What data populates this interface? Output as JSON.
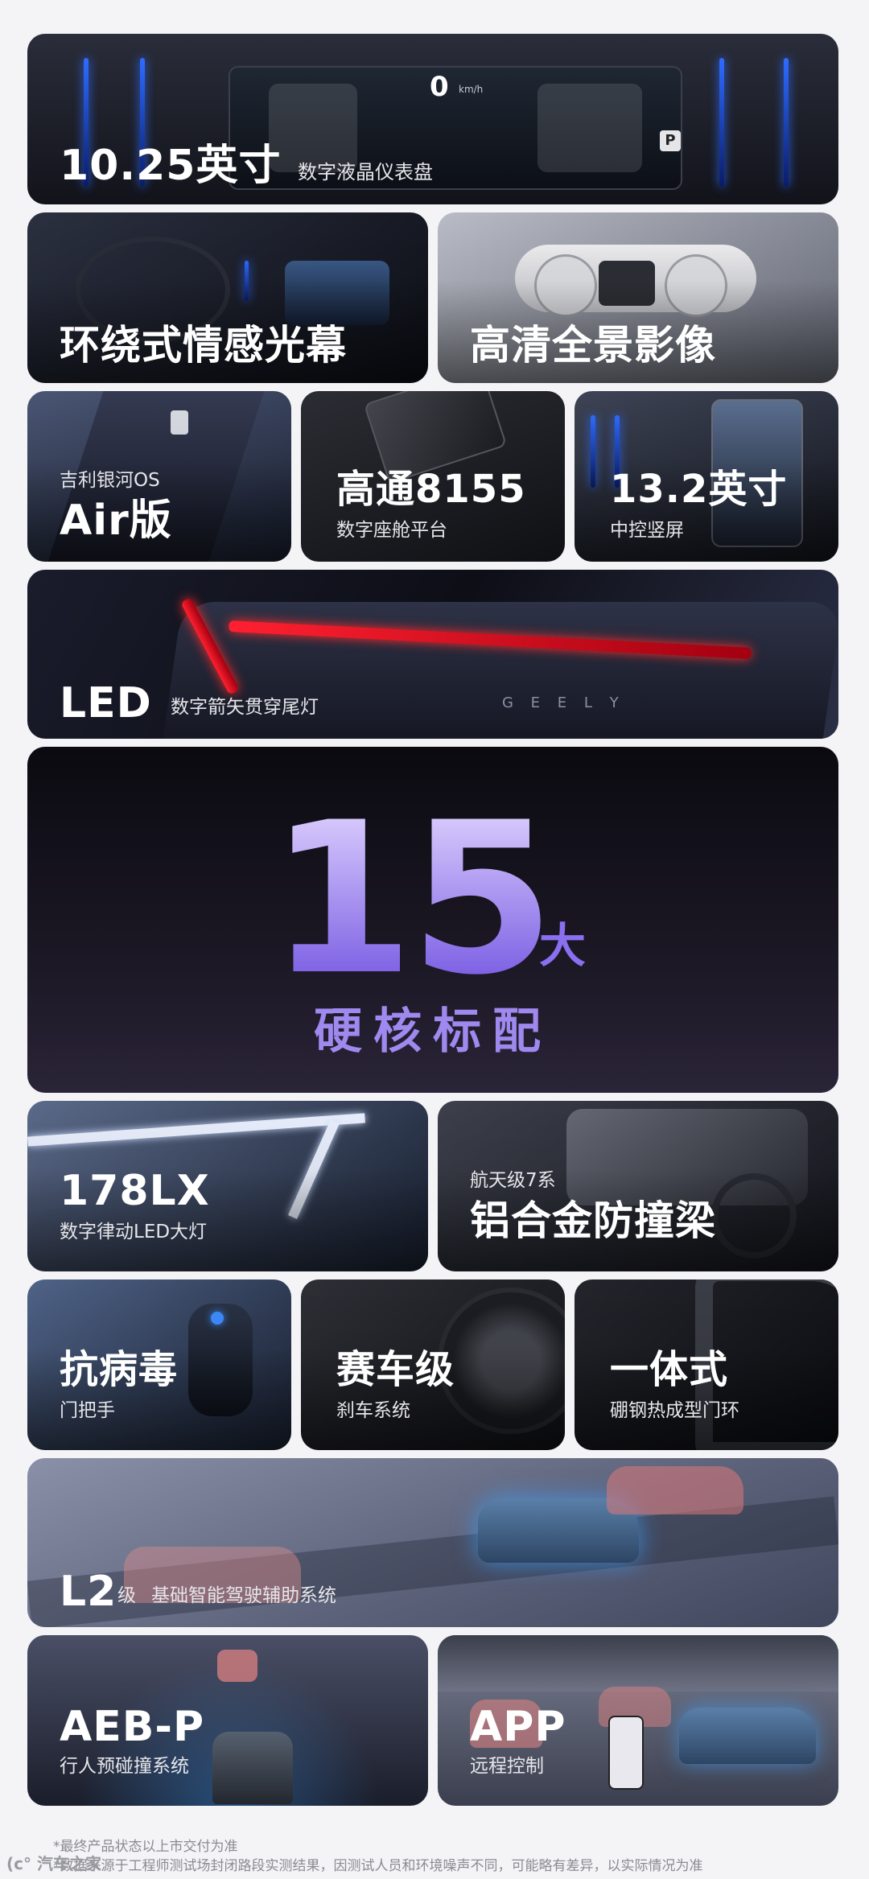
{
  "cards": {
    "dash": {
      "value": "10.25英寸",
      "label": "数字液晶仪表盘",
      "speed": "0",
      "speed_unit": "km/h",
      "gear": "P"
    },
    "lightscreen": {
      "title": "环绕式情感光幕"
    },
    "panorama": {
      "title": "高清全景影像"
    },
    "os": {
      "top": "吉利银河OS",
      "title": "Air版"
    },
    "chip": {
      "title": "高通8155",
      "label": "数字座舱平台"
    },
    "screen": {
      "title": "13.2英寸",
      "label": "中控竖屏"
    },
    "led": {
      "title": "LED",
      "label": "数字箭矢贯穿尾灯",
      "brand": "G E E L Y"
    },
    "hero": {
      "number": "15",
      "suffix": "大",
      "subtitle": "硬核标配"
    },
    "headlight": {
      "title": "178LX",
      "label": "数字律动LED大灯"
    },
    "beam": {
      "top": "航天级7系",
      "title": "铝合金防撞梁"
    },
    "antivirus": {
      "title": "抗病毒",
      "label": "门把手"
    },
    "brake": {
      "title": "赛车级",
      "label": "刹车系统"
    },
    "door": {
      "title": "一体式",
      "label": "硼钢热成型门环"
    },
    "l2": {
      "title": "L2",
      "grade": "级",
      "label": "基础智能驾驶辅助系统"
    },
    "aeb": {
      "title": "AEB-P",
      "label": "行人预碰撞系统"
    },
    "app": {
      "title": "APP",
      "label": "远程控制"
    }
  },
  "footer": {
    "line1": "*最终产品状态以上市交付为准",
    "line2": "*数据来源于工程师测试场封闭路段实测结果，因测试人员和环境噪声不同，可能略有差异，以实际情况为准",
    "logo": "(c° 汽车之家"
  },
  "colors": {
    "hero_gradient_top": "#d9c9ff",
    "hero_gradient_bottom": "#6a4fd8",
    "accent_blue": "#2f6bff",
    "lamp_red": "#ff2030"
  }
}
